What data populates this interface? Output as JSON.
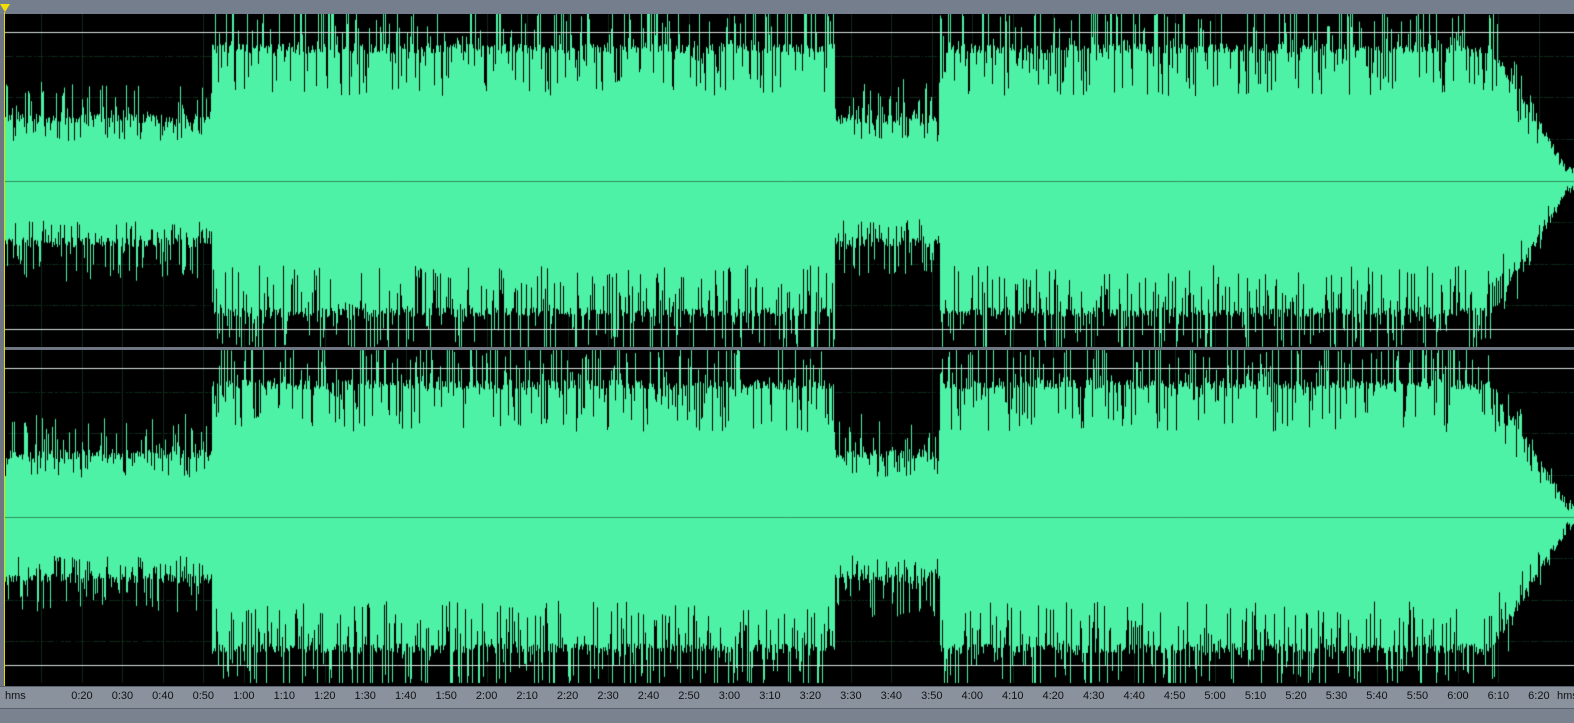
{
  "app": {
    "view": "waveform-editor",
    "channels": [
      "left",
      "right"
    ]
  },
  "colors": {
    "waveform": "#4df2a6",
    "background": "#000000",
    "grid": "#0c2a18",
    "centerline": "#2f8f62",
    "limit_lines": "#d8e0dc",
    "chrome": "#6e7682",
    "marker": "#f2e000"
  },
  "timeline": {
    "unit_label": "hms",
    "unit_label_end": "hms",
    "duration_seconds": 387,
    "ticks": [
      "0:20",
      "0:30",
      "0:40",
      "0:50",
      "1:00",
      "1:10",
      "1:20",
      "1:30",
      "1:40",
      "1:50",
      "2:00",
      "2:10",
      "2:20",
      "2:30",
      "2:40",
      "2:50",
      "3:00",
      "3:10",
      "3:20",
      "3:30",
      "3:40",
      "3:50",
      "4:00",
      "4:10",
      "4:20",
      "4:30",
      "4:40",
      "4:50",
      "5:00",
      "5:10",
      "5:20",
      "5:30",
      "5:40",
      "5:50",
      "6:00",
      "6:10",
      "6:20"
    ]
  },
  "waveform": {
    "sections": [
      {
        "start": "0:00",
        "end": "0:52",
        "level": "quiet"
      },
      {
        "start": "0:52",
        "end": "3:26",
        "level": "loud"
      },
      {
        "start": "3:26",
        "end": "3:52",
        "level": "quiet"
      },
      {
        "start": "3:52",
        "end": "6:08",
        "level": "loud"
      },
      {
        "start": "6:08",
        "end": "6:27",
        "level": "fade-out"
      }
    ]
  }
}
